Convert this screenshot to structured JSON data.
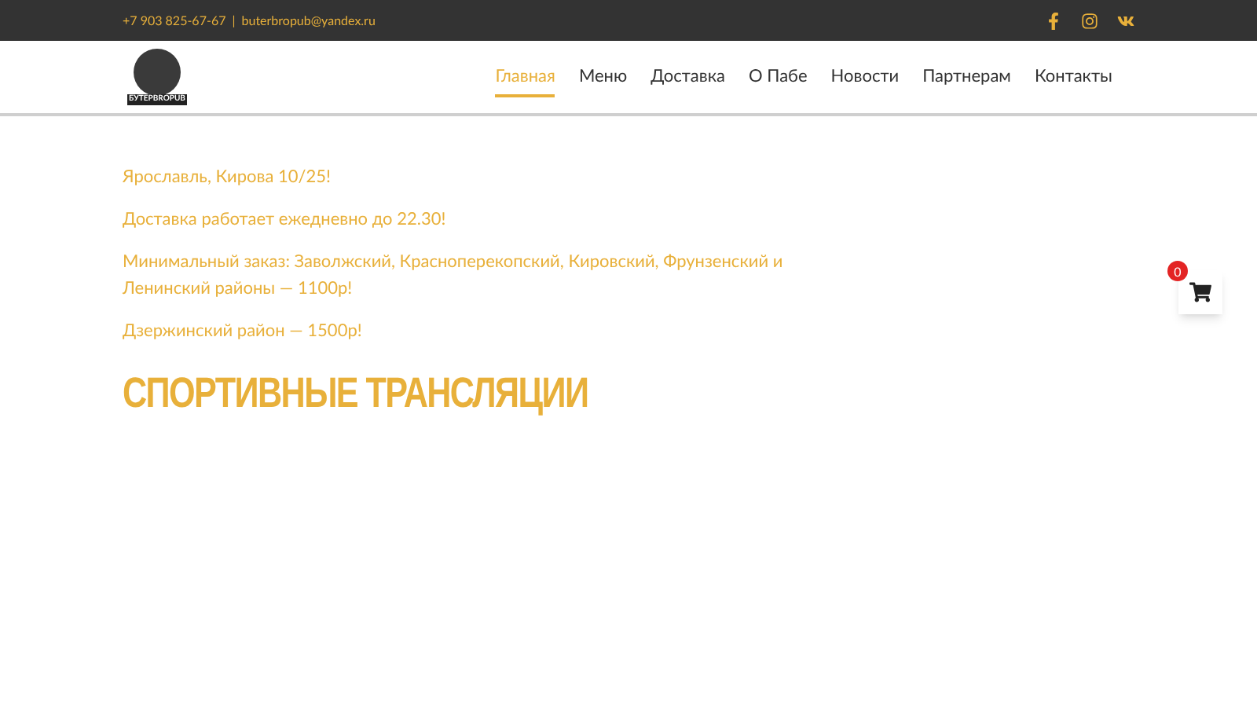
{
  "top_bar": {
    "phone": "+7 903 825-67-67",
    "separator": "|",
    "email": "buterbropub@yandex.ru"
  },
  "logo": {
    "text": "БУТЕРBROPUB"
  },
  "nav": [
    {
      "label": "Главная",
      "selected": true
    },
    {
      "label": "Меню",
      "selected": false
    },
    {
      "label": "Доставка",
      "selected": false
    },
    {
      "label": "О Пабе",
      "selected": false
    },
    {
      "label": "Новости",
      "selected": false
    },
    {
      "label": "Партнерам",
      "selected": false
    },
    {
      "label": "Контакты",
      "selected": false
    }
  ],
  "content": {
    "paragraphs": [
      "Ярославль, Кирова 10/25!",
      "Доставка  работает ежедневно до 22.30!",
      "Минимальный заказ: Заволжский, Красноперекопский, Кировский, Фрунзенский и Ленинский районы — 1100р!",
      "Дзержинский район — 1500р!"
    ],
    "heading": "СПОРТИВНЫЕ ТРАНСЛЯЦИИ"
  },
  "cart": {
    "count": "0"
  }
}
